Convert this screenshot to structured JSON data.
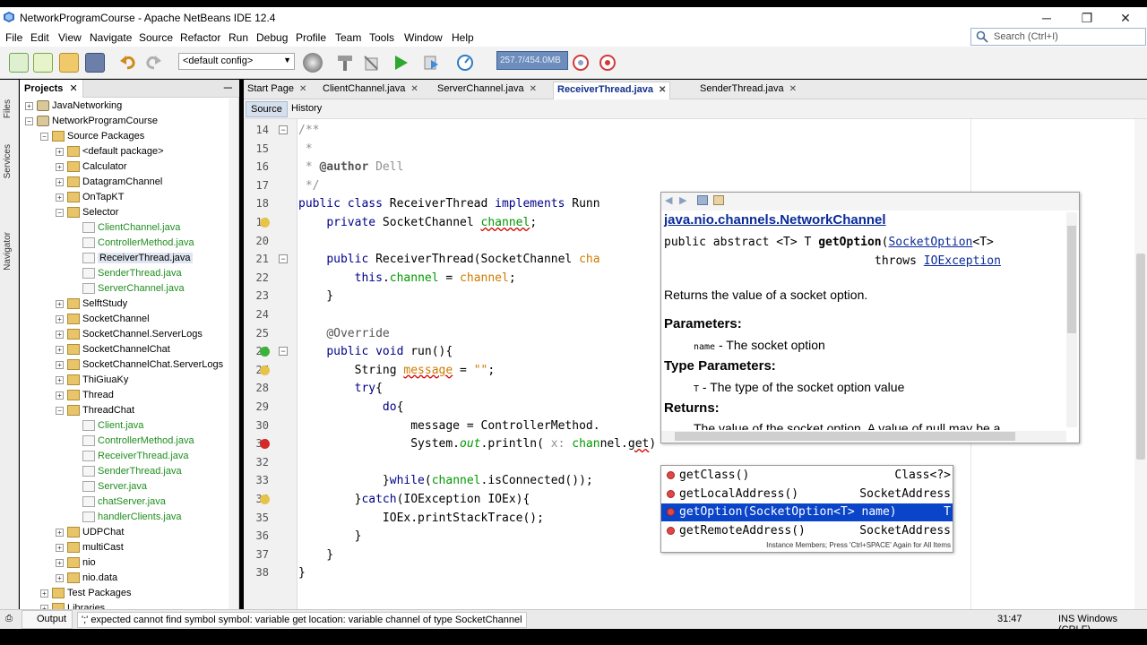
{
  "window": {
    "title": "NetworkProgramCourse - Apache NetBeans IDE 12.4",
    "controls": [
      "─",
      "❐",
      "✕"
    ]
  },
  "menu": [
    "File",
    "Edit",
    "View",
    "Navigate",
    "Source",
    "Refactor",
    "Run",
    "Debug",
    "Profile",
    "Team",
    "Tools",
    "Window",
    "Help"
  ],
  "search": {
    "placeholder": "Search (Ctrl+I)"
  },
  "toolbar": {
    "config": "<default config>",
    "memory": "257.7/454.0MB"
  },
  "side_strip": {
    "files": "Files",
    "services": "Services",
    "navigator": "Navigator"
  },
  "projects": {
    "tab_label": "Projects",
    "tree": [
      {
        "label": "JavaNetworking",
        "level": 0,
        "kind": "proj",
        "exp": "+"
      },
      {
        "label": "NetworkProgramCourse",
        "level": 0,
        "kind": "proj",
        "exp": "−"
      },
      {
        "label": "Source Packages",
        "level": 1,
        "kind": "pkg",
        "exp": "−"
      },
      {
        "label": "<default package>",
        "level": 2,
        "kind": "pkg",
        "exp": "+"
      },
      {
        "label": "Calculator",
        "level": 2,
        "kind": "pkg",
        "exp": "+"
      },
      {
        "label": "DatagramChannel",
        "level": 2,
        "kind": "pkg",
        "exp": "+"
      },
      {
        "label": "OnTapKT",
        "level": 2,
        "kind": "pkg",
        "exp": "+"
      },
      {
        "label": "Selector",
        "level": 2,
        "kind": "pkg",
        "exp": "−"
      },
      {
        "label": "ClientChannel.java",
        "level": 3,
        "kind": "file",
        "green": true
      },
      {
        "label": "ControllerMethod.java",
        "level": 3,
        "kind": "file",
        "green": true
      },
      {
        "label": "ReceiverThread.java",
        "level": 3,
        "kind": "file",
        "selected": true
      },
      {
        "label": "SenderThread.java",
        "level": 3,
        "kind": "file",
        "green": true
      },
      {
        "label": "ServerChannel.java",
        "level": 3,
        "kind": "file",
        "green": true
      },
      {
        "label": "SelftStudy",
        "level": 2,
        "kind": "pkg",
        "exp": "+"
      },
      {
        "label": "SocketChannel",
        "level": 2,
        "kind": "pkg",
        "exp": "+"
      },
      {
        "label": "SocketChannel.ServerLogs",
        "level": 2,
        "kind": "pkg",
        "exp": "+"
      },
      {
        "label": "SocketChannelChat",
        "level": 2,
        "kind": "pkg",
        "exp": "+"
      },
      {
        "label": "SocketChannelChat.ServerLogs",
        "level": 2,
        "kind": "pkg",
        "exp": "+"
      },
      {
        "label": "ThiGiuaKy",
        "level": 2,
        "kind": "pkg",
        "exp": "+"
      },
      {
        "label": "Thread",
        "level": 2,
        "kind": "pkg",
        "exp": "+"
      },
      {
        "label": "ThreadChat",
        "level": 2,
        "kind": "pkg",
        "exp": "−"
      },
      {
        "label": "Client.java",
        "level": 3,
        "kind": "file",
        "green": true
      },
      {
        "label": "ControllerMethod.java",
        "level": 3,
        "kind": "file",
        "green": true
      },
      {
        "label": "ReceiverThread.java",
        "level": 3,
        "kind": "file",
        "green": true
      },
      {
        "label": "SenderThread.java",
        "level": 3,
        "kind": "file",
        "green": true
      },
      {
        "label": "Server.java",
        "level": 3,
        "kind": "file",
        "green": true
      },
      {
        "label": "chatServer.java",
        "level": 3,
        "kind": "file",
        "green": true
      },
      {
        "label": "handlerClients.java",
        "level": 3,
        "kind": "file",
        "green": true
      },
      {
        "label": "UDPChat",
        "level": 2,
        "kind": "pkg",
        "exp": "+"
      },
      {
        "label": "multiCast",
        "level": 2,
        "kind": "pkg",
        "exp": "+"
      },
      {
        "label": "nio",
        "level": 2,
        "kind": "pkg",
        "exp": "+"
      },
      {
        "label": "nio.data",
        "level": 2,
        "kind": "pkg",
        "exp": "+"
      },
      {
        "label": "Test Packages",
        "level": 1,
        "kind": "pkg",
        "exp": "+"
      },
      {
        "label": "Libraries",
        "level": 1,
        "kind": "pkg",
        "exp": "+"
      }
    ]
  },
  "editor": {
    "tabs": [
      {
        "label": "Start Page"
      },
      {
        "label": "ClientChannel.java"
      },
      {
        "label": "ServerChannel.java"
      },
      {
        "label": "ReceiverThread.java",
        "active": true
      },
      {
        "label": "SenderThread.java"
      }
    ],
    "subtabs": [
      "Source",
      "History"
    ],
    "lines": [
      {
        "n": "14",
        "html": "<span class='cm'>/**</span>"
      },
      {
        "n": "15",
        "html": "<span class='cm'> *</span>"
      },
      {
        "n": "16",
        "html": "<span class='cm'> * <b class='ann'>@author</b> Dell</span>"
      },
      {
        "n": "17",
        "html": "<span class='cm'> */</span>"
      },
      {
        "n": "18",
        "html": "<span class='kw'>public class</span> ReceiverThread <span class='kw'>implements</span> Runn"
      },
      {
        "n": "19",
        "html": "    <span class='kw'>private</span> SocketChannel <span class='fld err'>channel</span>;"
      },
      {
        "n": "20",
        "html": ""
      },
      {
        "n": "21",
        "html": "    <span class='kw'>public</span> ReceiverThread(SocketChannel <span class='str'>cha</span>"
      },
      {
        "n": "22",
        "html": "        <span class='kw'>this</span>.<span class='fld'>channel</span> = <span class='str'>channel</span>;"
      },
      {
        "n": "23",
        "html": "    }"
      },
      {
        "n": "24",
        "html": ""
      },
      {
        "n": "25",
        "html": "    <span class='ann'>@Override</span>"
      },
      {
        "n": "26",
        "html": "    <span class='kw'>public void</span> run(){"
      },
      {
        "n": "27",
        "html": "        String <span class='str err'>message</span> = <span class='str'>\"\"</span>;"
      },
      {
        "n": "28",
        "html": "        <span class='kw'>try</span>{"
      },
      {
        "n": "29",
        "html": "            <span class='kw'>do</span>{"
      },
      {
        "n": "30",
        "html": "                message = ControllerMethod."
      },
      {
        "n": "31",
        "html": "                System.<i class='fld'>out</i>.println( <span class='cm'>x:</span> <span class='fld'>chan</span>nel.<span class='err'>get</span>)"
      },
      {
        "n": "32",
        "html": ""
      },
      {
        "n": "33",
        "html": "            }<span class='kw'>while</span>(<span class='fld'>channel</span>.isConnected());"
      },
      {
        "n": "34",
        "html": "        }<span class='kw'>catch</span>(IOException IOEx){"
      },
      {
        "n": "35",
        "html": "            IOEx.printStackTrace();"
      },
      {
        "n": "36",
        "html": "        }"
      },
      {
        "n": "37",
        "html": "    }"
      },
      {
        "n": "38",
        "html": "}"
      }
    ]
  },
  "javadoc": {
    "class_link": "java.nio.channels.NetworkChannel",
    "sig_line1_prefix": "public abstract <T> T ",
    "sig_method": "getOption",
    "sig_paren": "(",
    "sig_param_type": "SocketOption",
    "sig_param_suffix": "<T>",
    "sig_throws": "throws ",
    "sig_exception": "IOException",
    "description": "Returns the value of a socket option.",
    "params_heading": "Parameters:",
    "param_name": "name",
    "param_desc": " - The socket option",
    "type_params_heading": "Type Parameters:",
    "type_param_name": "T",
    "type_param_desc": " - The type of the socket option value",
    "returns_heading": "Returns:",
    "returns_text": "The value of the socket option. A value of null may be a"
  },
  "completion": {
    "items": [
      {
        "name": "getClass()",
        "type": "Class<?>"
      },
      {
        "name": "getLocalAddress()",
        "type": "SocketAddress"
      },
      {
        "name": "getOption(SocketOption<T> name)",
        "type": "T",
        "selected": true
      },
      {
        "name": "getRemoteAddress()",
        "type": "SocketAddress"
      }
    ],
    "hint": "Instance Members; Press 'Ctrl+SPACE' Again for All Items"
  },
  "status": {
    "output_label": "Output",
    "message": "';' expected  cannot find symbol   symbol:  variable get   location: variable channel of type SocketChannel",
    "position": "31:47",
    "mode": "INS Windows (CRLF)"
  }
}
